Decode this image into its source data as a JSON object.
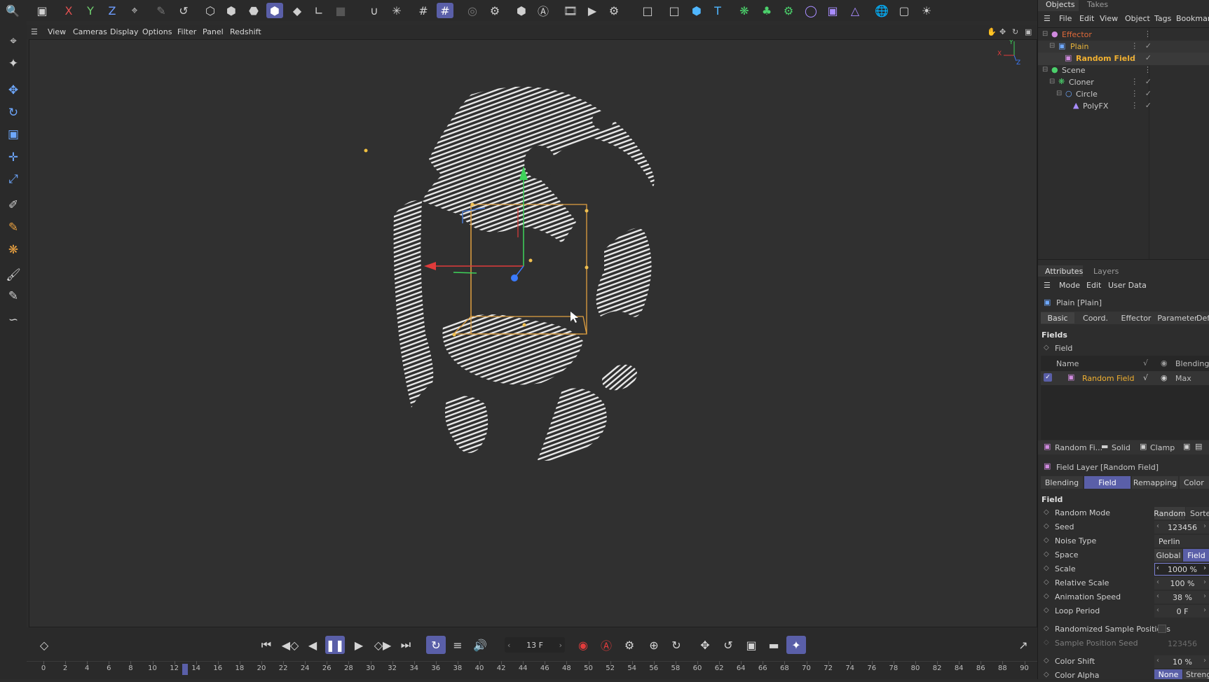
{
  "toolbar": {
    "icons": [
      "search-icon",
      "clapper-icon",
      "axis-x-icon",
      "axis-y-icon",
      "axis-z-icon",
      "coordinate-system-icon",
      "brush-icon",
      "undo-icon",
      "points-mode-icon",
      "edges-mode-icon",
      "polygons-mode-icon",
      "model-mode-icon",
      "texture-mode-icon",
      "axis-mode-icon",
      "solo-icon",
      "magnet-icon",
      "snap-settings-icon",
      "grid-icon",
      "workplane-icon",
      "render-region-icon",
      "render-settings-icon",
      "cube-shade-icon",
      "text-tool-icon",
      "film-icon",
      "render-view-icon",
      "render-picture-viewer-icon",
      "spline-pen-icon",
      "cube-icon",
      "primitive-cube-icon",
      "text-spline-icon",
      "mograph-cloner-icon",
      "fields-icon",
      "effector-gear-icon",
      "deformer-icon",
      "generator-icon",
      "scene-icon",
      "environment-icon",
      "camera-icon",
      "light-icon"
    ],
    "labels": {
      "x": "X",
      "y": "Y",
      "z": "Z"
    }
  },
  "viewport_menu": {
    "items": [
      "View",
      "Cameras",
      "Display",
      "Options",
      "Filter",
      "Panel",
      "Redshift"
    ]
  },
  "axis_indicator": {
    "x": "X",
    "y": "Y",
    "z": "Z"
  },
  "objects_panel": {
    "tabs": [
      "Objects",
      "Takes"
    ],
    "menu": [
      "File",
      "Edit",
      "View",
      "Object",
      "Tags",
      "Bookmarks"
    ],
    "rows": [
      {
        "label": "Effector",
        "color": "#e06a3a",
        "indent": 0
      },
      {
        "label": "Plain",
        "color": "#e8b43a",
        "indent": 1
      },
      {
        "label": "Random Field",
        "color": "#f0b030",
        "indent": 2
      },
      {
        "label": "Scene",
        "color": "#c8c8c8",
        "indent": 0
      },
      {
        "label": "Cloner",
        "color": "#c8c8c8",
        "indent": 1
      },
      {
        "label": "Circle",
        "color": "#c8c8c8",
        "indent": 2
      },
      {
        "label": "PolyFX",
        "color": "#c8c8c8",
        "indent": 3
      }
    ]
  },
  "attributes_panel": {
    "tabs": [
      "Attributes",
      "Layers"
    ],
    "menu": [
      "Mode",
      "Edit",
      "User Data"
    ],
    "object_title": "Plain [Plain]",
    "tabs_row": [
      "Basic",
      "Coord.",
      "Effector",
      "Parameter",
      "Deformer"
    ],
    "fields_label": "Fields",
    "field_label": "Field",
    "list_header": {
      "name": "Name",
      "blending": "Blending"
    },
    "list_item": {
      "name": "Random Field",
      "blending": "Max"
    },
    "layer_bar": {
      "item": "Random Fi...",
      "solid": "Solid",
      "clamp": "Clamp"
    },
    "layer_title": "Field Layer [Random Field]",
    "sub_tabs": [
      "Blending",
      "Field",
      "Remapping",
      "Color"
    ],
    "active_sub_tab": "Field",
    "section": "Field",
    "rows": [
      {
        "name": "Random Mode",
        "value": "Random",
        "value2": "Sorted"
      },
      {
        "name": "Seed",
        "value": "123456"
      },
      {
        "name": "Noise Type",
        "value": "Perlin"
      },
      {
        "name": "Space",
        "value": "Global",
        "value2": "Field"
      },
      {
        "name": "Scale",
        "value": "1000 %"
      },
      {
        "name": "Relative Scale",
        "value": "100 %"
      },
      {
        "name": "Animation Speed",
        "value": "38 %"
      },
      {
        "name": "Loop Period",
        "value": "0 F"
      },
      {
        "name": "Randomized Sample Positions",
        "value": ""
      },
      {
        "name": "Sample Position Seed",
        "value": "123456"
      },
      {
        "name": "Color Shift",
        "value": "10 %"
      },
      {
        "name": "Color Alpha",
        "value": "None",
        "value2": "Strength"
      }
    ]
  },
  "timeline": {
    "current_frame": "13 F",
    "ruler": [
      "0",
      "2",
      "4",
      "6",
      "8",
      "10",
      "12",
      "14",
      "16",
      "18",
      "20",
      "22",
      "24",
      "26",
      "28",
      "30",
      "32",
      "34",
      "36",
      "38",
      "40",
      "42",
      "44",
      "46",
      "48",
      "50",
      "52",
      "54",
      "56",
      "58",
      "60",
      "62",
      "64",
      "66",
      "68",
      "70",
      "72",
      "74",
      "76",
      "78",
      "80",
      "82",
      "84",
      "86",
      "88",
      "90"
    ],
    "playhead_frame": 13
  },
  "colors": {
    "accent": "#5a5fa8",
    "orange_selection": "#e0a040",
    "record_red": "#e23c3c"
  }
}
